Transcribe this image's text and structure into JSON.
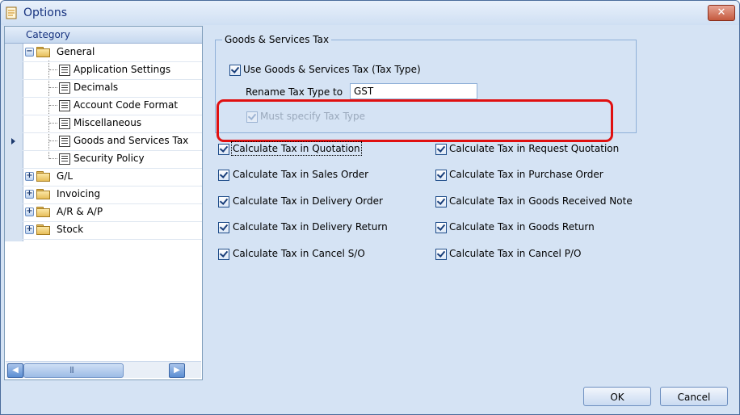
{
  "window": {
    "title": "Options",
    "close_label": "✕"
  },
  "tree": {
    "header": "Category",
    "general": "General",
    "children": [
      "Application Settings",
      "Decimals",
      "Account Code Format",
      "Miscellaneous",
      "Goods and Services Tax",
      "Security Policy"
    ],
    "others": [
      "G/L",
      "Invoicing",
      "A/R & A/P",
      "Stock"
    ],
    "selected": "Goods and Services Tax",
    "scroll_grip": "|||"
  },
  "gst": {
    "group_title": "Goods & Services Tax",
    "use_gst_label": "Use Goods & Services Tax (Tax Type)",
    "use_gst_checked": true,
    "rename_label": "Rename Tax Type to",
    "rename_value": "GST",
    "must_specify_label": "Must specify Tax Type",
    "must_specify_checked": true,
    "must_specify_disabled": true
  },
  "options_left": [
    "Calculate Tax in Quotation",
    "Calculate Tax in Sales Order",
    "Calculate Tax in Delivery Order",
    "Calculate Tax in Delivery Return",
    "Calculate Tax in Cancel S/O"
  ],
  "options_right": [
    "Calculate Tax in Request Quotation",
    "Calculate Tax in Purchase Order",
    "Calculate Tax in Goods Received Note",
    "Calculate Tax in Goods Return",
    "Calculate Tax in Cancel P/O"
  ],
  "buttons": {
    "ok": "OK",
    "cancel": "Cancel"
  },
  "colors": {
    "highlight": "#e01010",
    "window_bg": "#d5e3f4",
    "title_text": "#15317e"
  },
  "icons": [
    "options-app-icon",
    "close-icon",
    "folder-icon",
    "expand-icon",
    "collapse-icon",
    "settings-page-icon",
    "row-selector-icon",
    "scroll-left-icon",
    "scroll-right-icon",
    "checkmark-icon"
  ]
}
